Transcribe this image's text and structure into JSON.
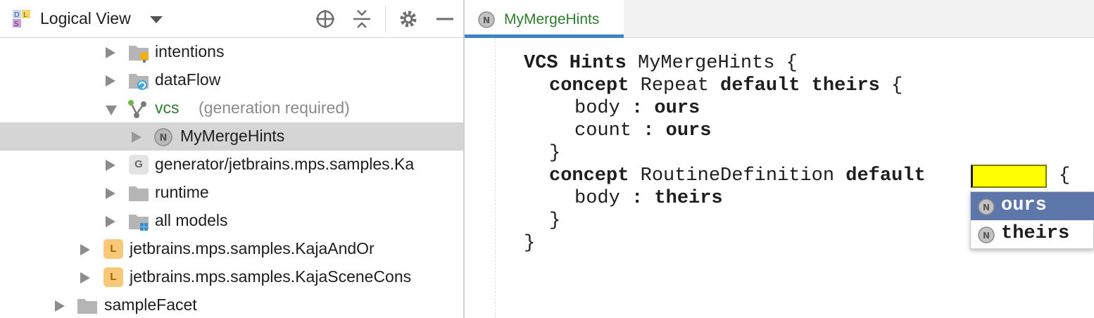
{
  "colors": {
    "accent": "#4083c9",
    "selection": "#d5d5d5",
    "green_text": "#2d7d2d",
    "hint_text": "#8a8a8a",
    "cell_highlight": "#ffff00",
    "completion_active": "#5d77ab"
  },
  "left_panel": {
    "title": "Logical View",
    "logo_icon": "dsl-logo-icon",
    "toolbar_icons": [
      "locate-icon",
      "collapse-all-icon",
      "gear-icon",
      "minimize-icon"
    ],
    "tree": [
      {
        "label": "intentions",
        "icon": "folder-bulb-icon",
        "expanded": false
      },
      {
        "label": "dataFlow",
        "icon": "folder-dataflow-icon",
        "expanded": false
      },
      {
        "label": "vcs",
        "hint": "(generation required)",
        "icon": "vcs-branch-icon",
        "expanded": true
      },
      {
        "label": "MyMergeHints",
        "icon": "node-n-icon",
        "expanded": false,
        "selected": true
      },
      {
        "label": "generator/jetbrains.mps.samples.Ka",
        "icon": "generator-g-icon",
        "badge": "G",
        "expanded": false
      },
      {
        "label": "runtime",
        "icon": "folder-icon",
        "expanded": false
      },
      {
        "label": "all models",
        "icon": "folder-models-icon",
        "expanded": false
      },
      {
        "label": "jetbrains.mps.samples.KajaAndOr",
        "icon": "language-l-icon",
        "badge": "L",
        "expanded": false
      },
      {
        "label": "jetbrains.mps.samples.KajaSceneCons",
        "icon": "language-l-icon",
        "badge": "L",
        "expanded": false
      },
      {
        "label": "sampleFacet",
        "icon": "folder-icon",
        "expanded": false
      }
    ]
  },
  "editor": {
    "tab": {
      "label": "MyMergeHints",
      "icon": "node-n-icon",
      "badge": "N"
    },
    "code": {
      "l1_kw": "VCS Hints",
      "l1_name": " MyMergeHints {",
      "l2_kw1": "concept",
      "l2_name": " Repeat ",
      "l2_kw2": "default theirs",
      "l2_tail": " {",
      "l3_name": "body ",
      "l3_kw": ": ours",
      "l4_name": "count ",
      "l4_kw": ": ours",
      "l5": "}",
      "l6_kw1": "concept",
      "l6_name": " RoutineDefinition ",
      "l6_kw2": "default",
      "l6_tail": "{",
      "l7_name": "body ",
      "l7_kw": ": theirs",
      "l8": "}",
      "l9": "}"
    },
    "completion": {
      "items": [
        {
          "label": "ours",
          "icon": "node-n-icon",
          "badge": "N",
          "active": true
        },
        {
          "label": "theirs",
          "icon": "node-n-icon",
          "badge": "N",
          "active": false
        }
      ]
    }
  }
}
